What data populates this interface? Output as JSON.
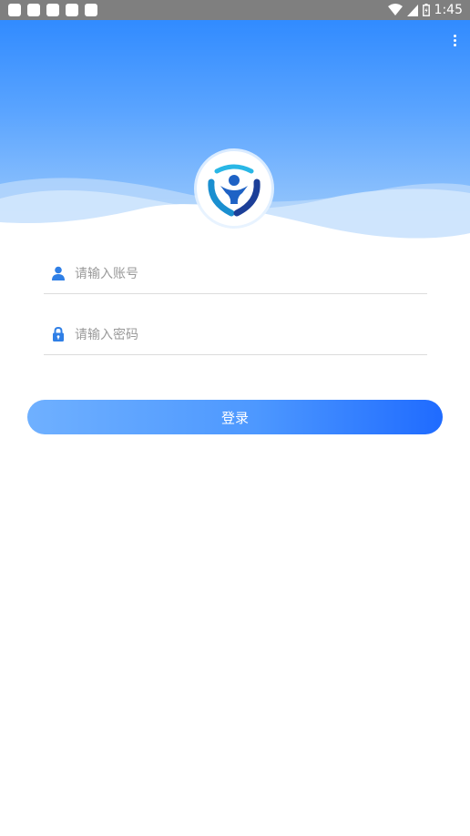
{
  "status_bar": {
    "time": "1:45",
    "icons": [
      "notification-icon",
      "notification-icon",
      "notification-icon",
      "notification-icon",
      "notification-icon",
      "wifi-icon",
      "signal-icon",
      "battery-icon"
    ]
  },
  "header": {
    "menu_icon": "more-vert-icon",
    "logo_icon": "app-logo"
  },
  "form": {
    "account": {
      "icon": "user-icon",
      "placeholder": "请输入账号",
      "value": ""
    },
    "password": {
      "icon": "lock-icon",
      "placeholder": "请输入密码",
      "value": ""
    },
    "login_label": "登录"
  },
  "colors": {
    "header_top": "#318bff",
    "header_bottom": "#a7d0fb",
    "button_start": "#6fb0ff",
    "button_end": "#1f6bff",
    "icon_blue": "#2f7fe6"
  }
}
